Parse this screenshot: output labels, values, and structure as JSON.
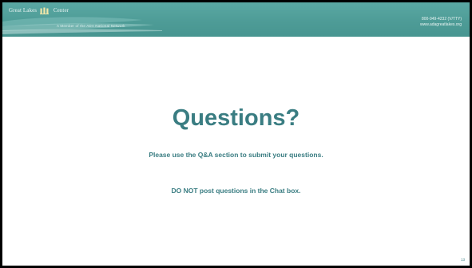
{
  "header": {
    "logo_text_left": "Great Lakes",
    "logo_text_right": "Center",
    "tagline": "A Member of the ADA National Network",
    "phone": "800-949-4232 (V/TTY)",
    "website": "www.adagreatlakes.org"
  },
  "slide": {
    "title": "Questions?",
    "line1": "Please use the Q&A section to submit your questions.",
    "line2": "DO NOT post questions in the Chat box.",
    "page_number": "13"
  },
  "colors": {
    "header_teal": "#4e9c97",
    "text_teal": "#3a7d82",
    "frame": "#000000",
    "background": "#ffffff"
  },
  "icons": {
    "logo": "pillars-logo-icon"
  }
}
